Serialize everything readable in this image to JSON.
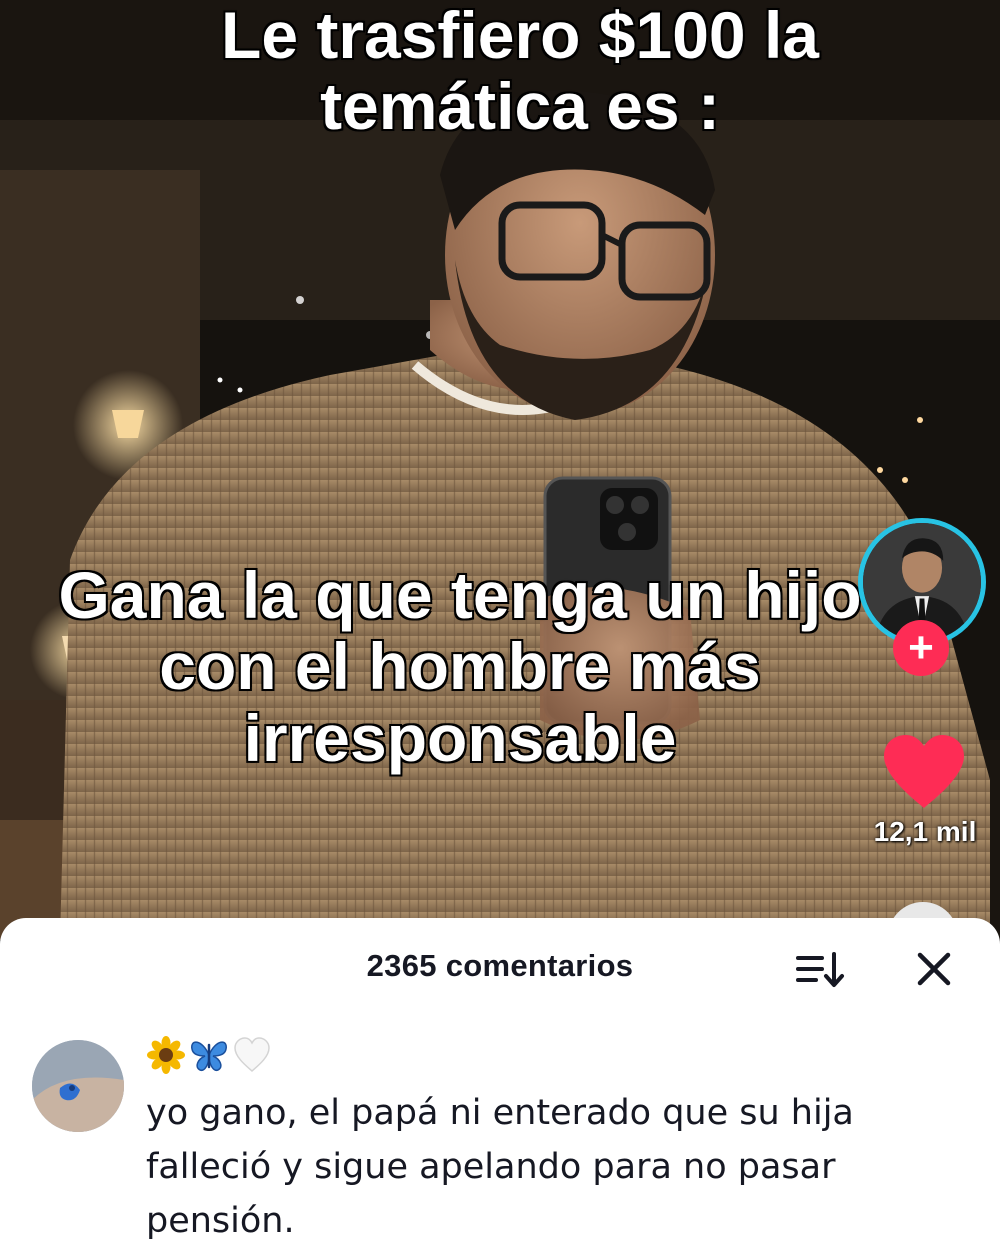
{
  "video": {
    "caption_top": "Le trasfiero $100 la temática es :",
    "caption_bottom": "Gana la que tenga un hijo con el hombre más irresponsable",
    "like_count": "12,1 mil",
    "follow_symbol": "+",
    "accent_color": "#fe2c55",
    "avatar_ring_color": "#28c3e4"
  },
  "comments": {
    "count_label": "2365 comentarios",
    "items": [
      {
        "user_emojis": [
          "sunflower-icon",
          "blue-butterfly-icon",
          "white-heart-icon"
        ],
        "text": "yo gano, el papá ni enterado que su hija falleció y sigue apelando para no pasar pensión."
      }
    ]
  }
}
